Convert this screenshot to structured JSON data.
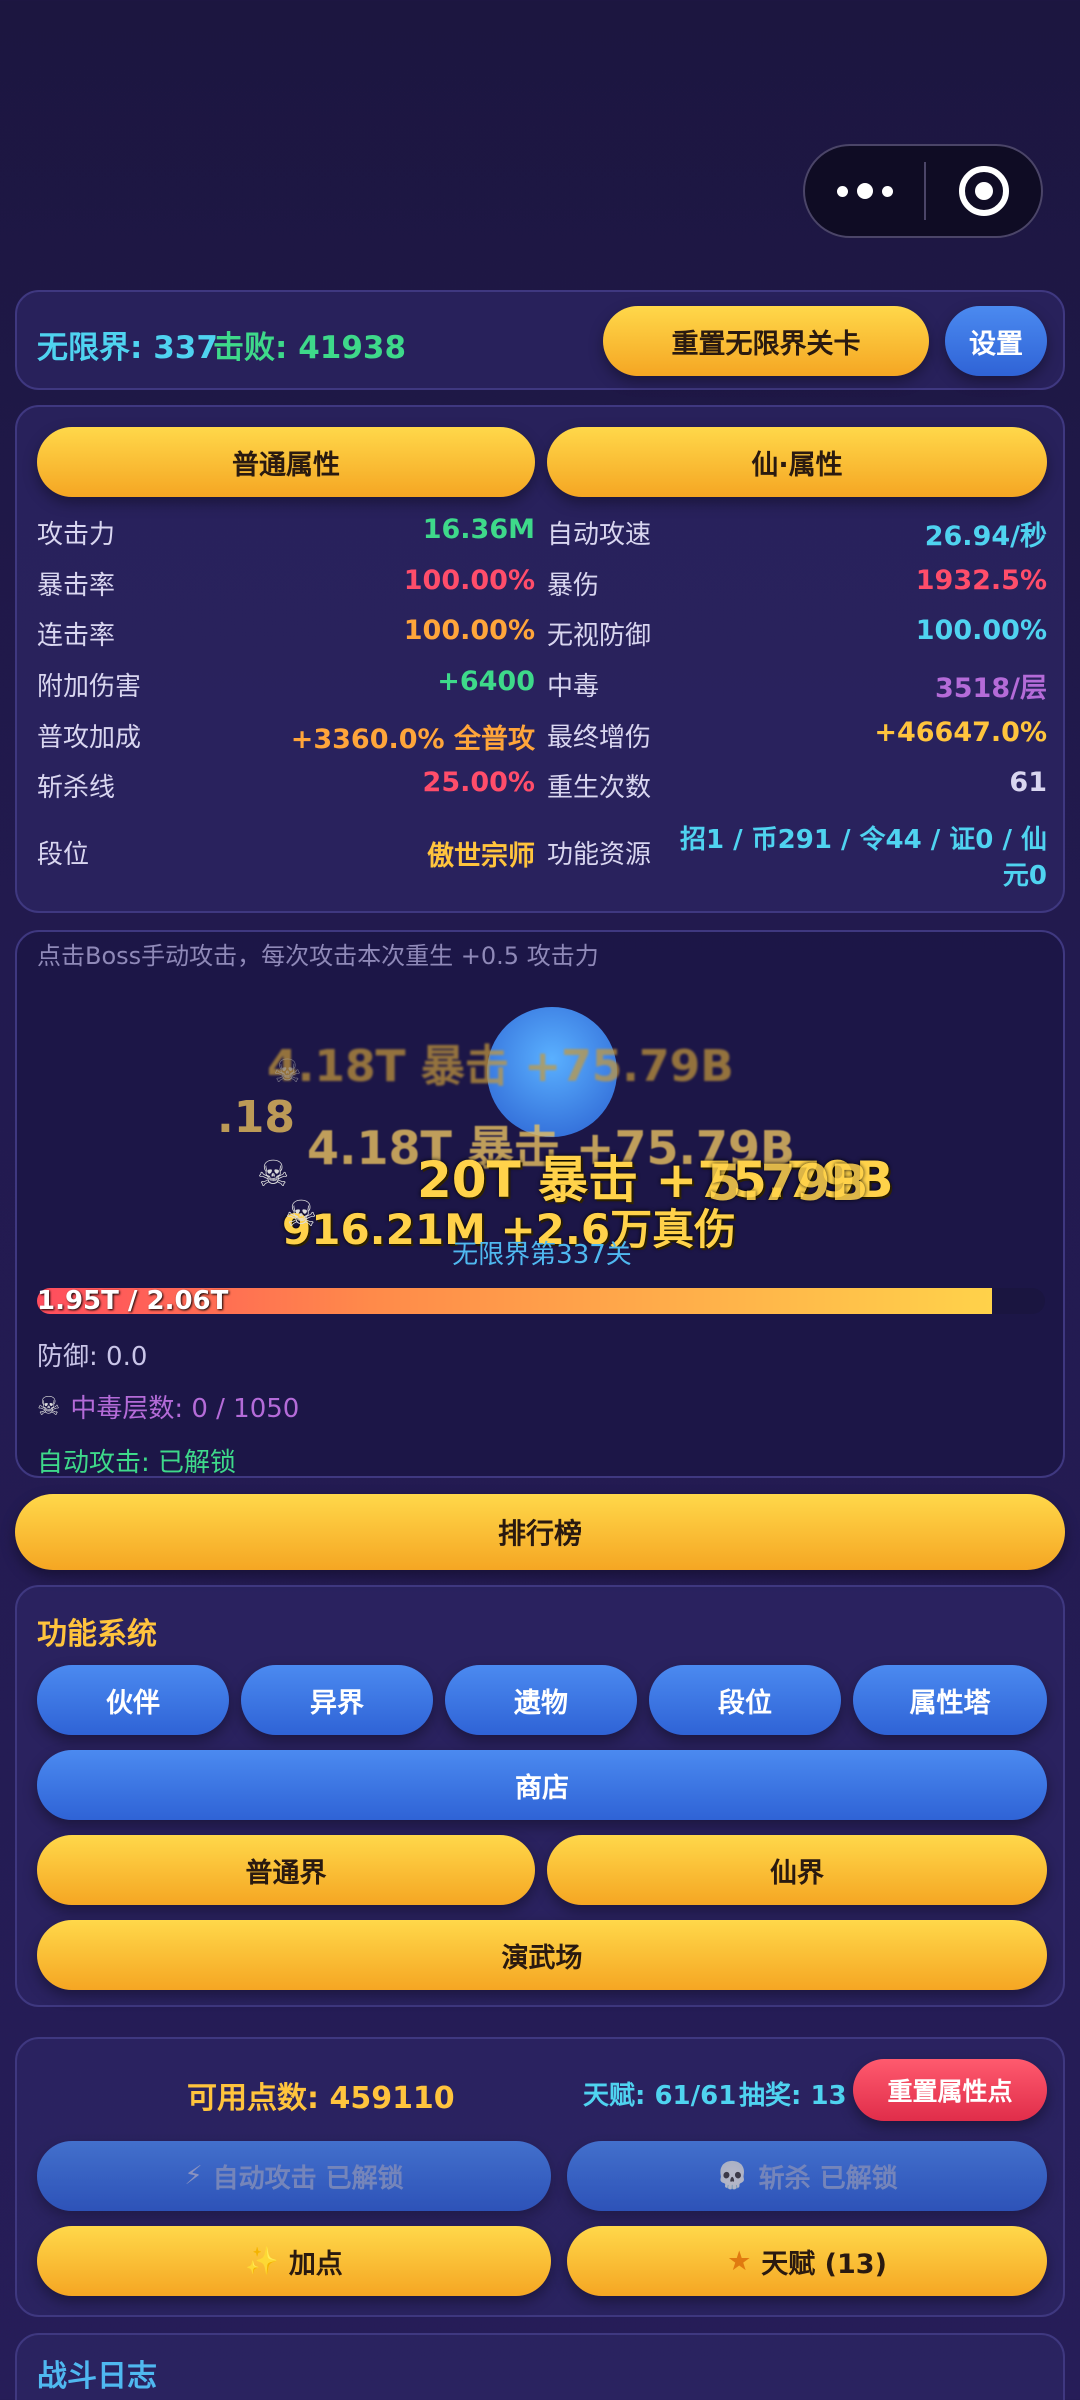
{
  "capsule": {
    "more_icon": "more-dots-icon",
    "close_icon": "target-circle-icon"
  },
  "topbar": {
    "level": "无限界: 337",
    "kills": "击败: 41938",
    "reset_btn": "重置无限界关卡",
    "settings_btn": "设置"
  },
  "attributes": {
    "tabs": [
      "普通属性",
      "仙·属性"
    ],
    "left": [
      {
        "label": "攻击力",
        "value": "16.36M",
        "color": "#3ed98a"
      },
      {
        "label": "暴击率",
        "value": "100.00%",
        "color": "#ff4d6a"
      },
      {
        "label": "连击率",
        "value": "100.00%",
        "color": "#ffa53a"
      },
      {
        "label": "附加伤害",
        "value": "+6400",
        "color": "#3ed98a"
      },
      {
        "label": "普攻加成",
        "value": "+3360.0% 全普攻",
        "color": "#ffa53a"
      },
      {
        "label": "斩杀线",
        "value": "25.00%",
        "color": "#ff4d6a"
      },
      {
        "label": "段位",
        "value": "傲世宗师",
        "color": "#ffc43d"
      }
    ],
    "right": [
      {
        "label": "自动攻速",
        "value": "26.94/秒",
        "color": "#4fd3f0"
      },
      {
        "label": "暴伤",
        "value": "1932.5%",
        "color": "#ff4d6a"
      },
      {
        "label": "无视防御",
        "value": "100.00%",
        "color": "#4fd3f0"
      },
      {
        "label": "中毒",
        "value": "3518/层",
        "color": "#b46bd8"
      },
      {
        "label": "最终增伤",
        "value": "+46647.0%",
        "color": "#ffc43d"
      },
      {
        "label": "重生次数",
        "value": "61",
        "color": "#d9d6f0"
      },
      {
        "label": "功能资源",
        "value_line1": "招1 / 币291 / 令44 / 证0 / 仙",
        "value_line2": "元0",
        "color": "#4fd3f0"
      }
    ]
  },
  "battle": {
    "hint": "点击Boss手动攻击，每次攻击本次重生 +0.5 攻击力",
    "floating_texts": [
      {
        "text": "4.18T 暴击 +75.79B",
        "color": "#ffd24a"
      },
      {
        "text": ".18",
        "color": "#ffd24a"
      },
      {
        "text": "20T 暴击 +75.79B",
        "color": "#ffd24a"
      },
      {
        "text": "916.21M +2.6万真伤",
        "color": "#ffd24a"
      },
      {
        "text": "5.79B",
        "color": "#ffd24a"
      }
    ],
    "stage_name": "无限界第337关",
    "hp_text": "1.95T / 2.06T",
    "hp_fraction": 0.947,
    "defense": "防御: 0.0",
    "poison": "中毒层数: 0 / 1050",
    "auto_attack": "自动攻击: 已解锁"
  },
  "leaderboard_btn": "排行榜",
  "functions": {
    "title": "功能系统",
    "row1": [
      "伙伴",
      "异界",
      "遗物",
      "段位",
      "属性塔"
    ],
    "shop": "商店",
    "realms": [
      "普通界",
      "仙界"
    ],
    "arena": "演武场"
  },
  "points": {
    "available": "可用点数: 459110",
    "talent": "天赋: 61/61",
    "lottery": "抽奖: 13",
    "reset_btn": "重置属性点",
    "auto_locked": "自动攻击 已解锁",
    "kill_locked": "斩杀 已解锁",
    "add_point": "加点",
    "talent_btn": "天赋 (13)"
  },
  "log": {
    "title": "战斗日志"
  }
}
